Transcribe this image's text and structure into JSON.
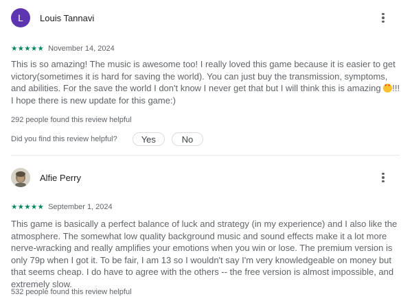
{
  "reviews": [
    {
      "author": "Louis Tannavi",
      "avatar_letter": "L",
      "avatar_color": "#5e35b1",
      "rating": 5,
      "stars": "★★★★★",
      "date": "November 14, 2024",
      "text_before_emoji": "This is so amazing! The music is awesome too! I really loved this game because it is easier to get victory(sometimes it is hard for saving the world). You can just buy the transmission, symptoms, and abilities. For the save the world I don't know I never get that but I will think this is amazing ",
      "emoji": "smiling-face-with-heart-eyes",
      "text_after_emoji": "!!! I hope there is new update for this game:)",
      "helpful_count": "292 people found this review helpful",
      "feedback_question": "Did you find this review helpful?",
      "yes_label": "Yes",
      "no_label": "No"
    },
    {
      "author": "Alfie Perry",
      "avatar_type": "photo",
      "rating": 5,
      "stars": "★★★★★",
      "date": "September 1, 2024",
      "text": "This game is basically a perfect balance of luck and strategy (in my experience) and I also like the atmosphere. The somewhat low quality background music and sound effects make it a lot more nerve-wracking and really amplifies your emotions when you win or lose. The premium version is only 79p when I got it. To be fair, I am 13 so I wouldn't say I'm very knowledgeable on money but that seems cheap. I do have to agree with the others -- the free version is almost impossible, and extremely slow.",
      "helpful_count": "532 people found this review helpful"
    }
  ],
  "colors": {
    "star": "#01875f",
    "text": "#5f6368",
    "author": "#202124",
    "divider": "#e8eaed"
  }
}
